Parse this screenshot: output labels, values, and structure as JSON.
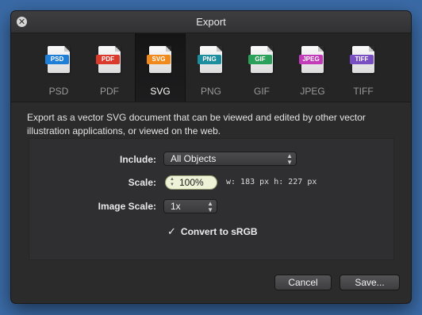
{
  "window": {
    "title": "Export",
    "close_glyph": "✕"
  },
  "formats": [
    {
      "id": "psd",
      "label": "PSD",
      "badge": "PSD",
      "color": "#1f7fd6",
      "selected": false
    },
    {
      "id": "pdf",
      "label": "PDF",
      "badge": "PDF",
      "color": "#d93a2b",
      "selected": false
    },
    {
      "id": "svg",
      "label": "SVG",
      "badge": "SVG",
      "color": "#f08a1c",
      "selected": true
    },
    {
      "id": "png",
      "label": "PNG",
      "badge": "PNG",
      "color": "#1d8ea0",
      "selected": false
    },
    {
      "id": "gif",
      "label": "GIF",
      "badge": "GIF",
      "color": "#2aa05a",
      "selected": false
    },
    {
      "id": "jpeg",
      "label": "JPEG",
      "badge": "JPEG",
      "color": "#c23bb8",
      "selected": false
    },
    {
      "id": "tiff",
      "label": "TIFF",
      "badge": "TIFF",
      "color": "#7a4fc1",
      "selected": false
    }
  ],
  "description": "Export as a vector SVG document that can be viewed and edited by other vector illustration applications, or viewed on the web.",
  "options": {
    "include": {
      "label": "Include:",
      "value": "All Objects"
    },
    "scale": {
      "label": "Scale:",
      "value": "100%",
      "dims": "w: 183 px  h: 227 px"
    },
    "image_scale": {
      "label": "Image Scale:",
      "value": "1x"
    },
    "convert_srgb": {
      "label": "Convert to sRGB",
      "checked": true,
      "glyph": "✓"
    }
  },
  "buttons": {
    "cancel": "Cancel",
    "save": "Save..."
  },
  "arrows": {
    "updown": "▲▼"
  }
}
